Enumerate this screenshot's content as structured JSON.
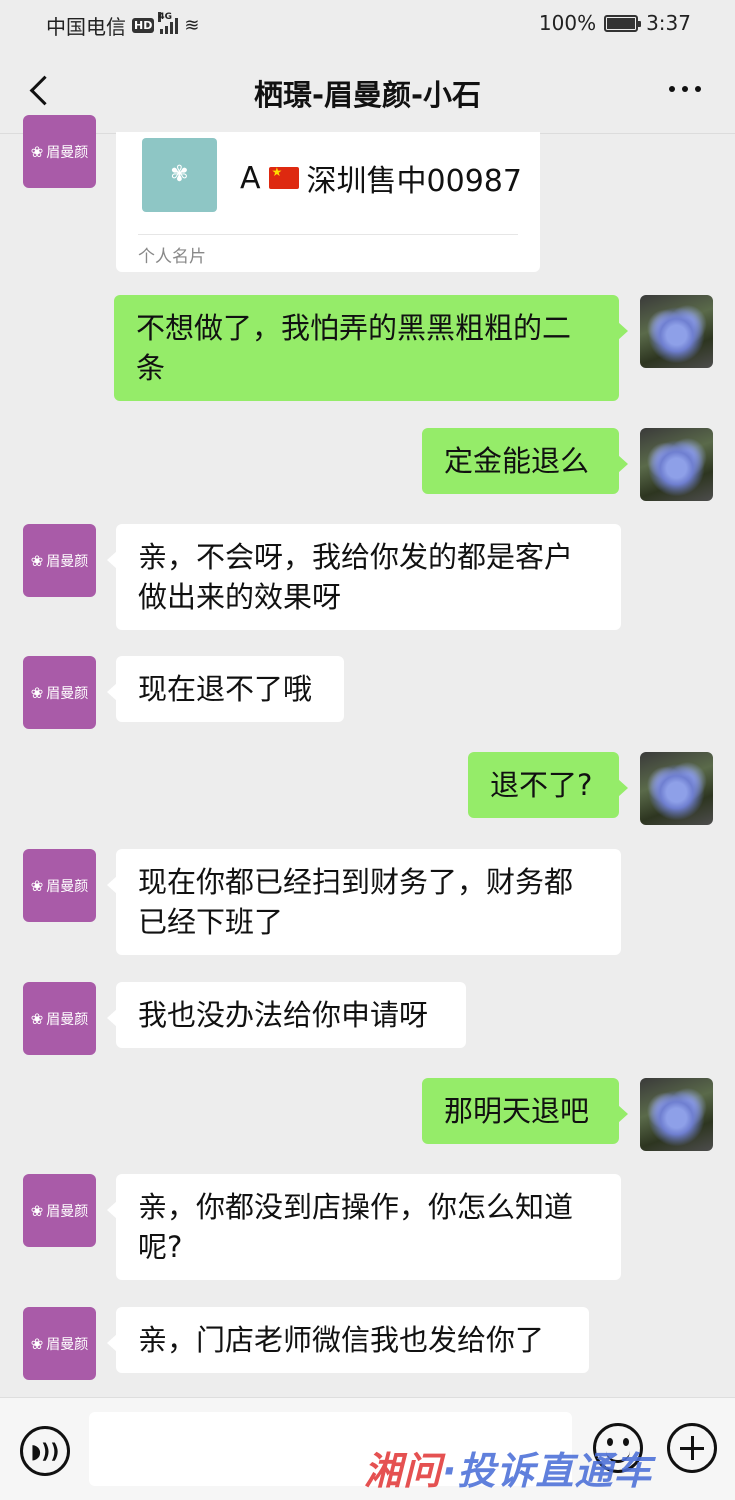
{
  "status_bar": {
    "carrier": "中国电信",
    "hd_badge": "HD",
    "network": "4G",
    "battery": "100%",
    "time": "3:37"
  },
  "nav": {
    "title": "栖璟-眉曼颜-小石"
  },
  "brand_avatar_text": "眉曼颜",
  "card": {
    "name": "A",
    "name_suffix": "深圳售中00987",
    "type_label": "个人名片"
  },
  "messages": [
    {
      "from": "me",
      "text": "不想做了，我怕弄的黑黑粗粗的二条"
    },
    {
      "from": "me",
      "text": "定金能退么"
    },
    {
      "from": "them",
      "text": "亲，不会呀，我给你发的都是客户做出来的效果呀"
    },
    {
      "from": "them",
      "text": "现在退不了哦"
    },
    {
      "from": "me",
      "text": "退不了?"
    },
    {
      "from": "them",
      "text": " 现在你都已经扫到财务了，财务都已经下班了"
    },
    {
      "from": "them",
      "text": "我也没办法给你申请呀"
    },
    {
      "from": "me",
      "text": "那明天退吧"
    },
    {
      "from": "them",
      "text": "亲，你都没到店操作，你怎么知道呢?"
    },
    {
      "from": "them",
      "text": "亲，门店老师微信我也发给你了"
    }
  ],
  "watermark": {
    "part1": "湘问",
    "part2": "·投诉直通车"
  },
  "icons": [
    "back-icon",
    "more-icon",
    "voice-icon",
    "emoji-icon",
    "plus-icon"
  ]
}
